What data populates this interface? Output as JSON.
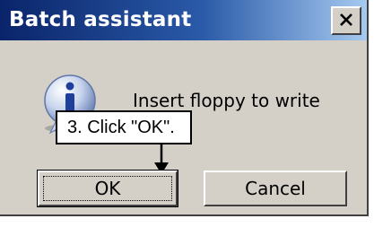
{
  "window": {
    "title": "Batch assistant",
    "close_icon": "close-icon"
  },
  "content": {
    "icon": "info-icon",
    "message": "Insert floppy to write"
  },
  "callout": {
    "text": "3. Click \"OK\"."
  },
  "buttons": {
    "ok_label": "OK",
    "cancel_label": "Cancel"
  },
  "colors": {
    "titlebar_start": "#0a246a",
    "titlebar_end": "#a6caf0",
    "dialog_bg": "#d4d0c8"
  }
}
